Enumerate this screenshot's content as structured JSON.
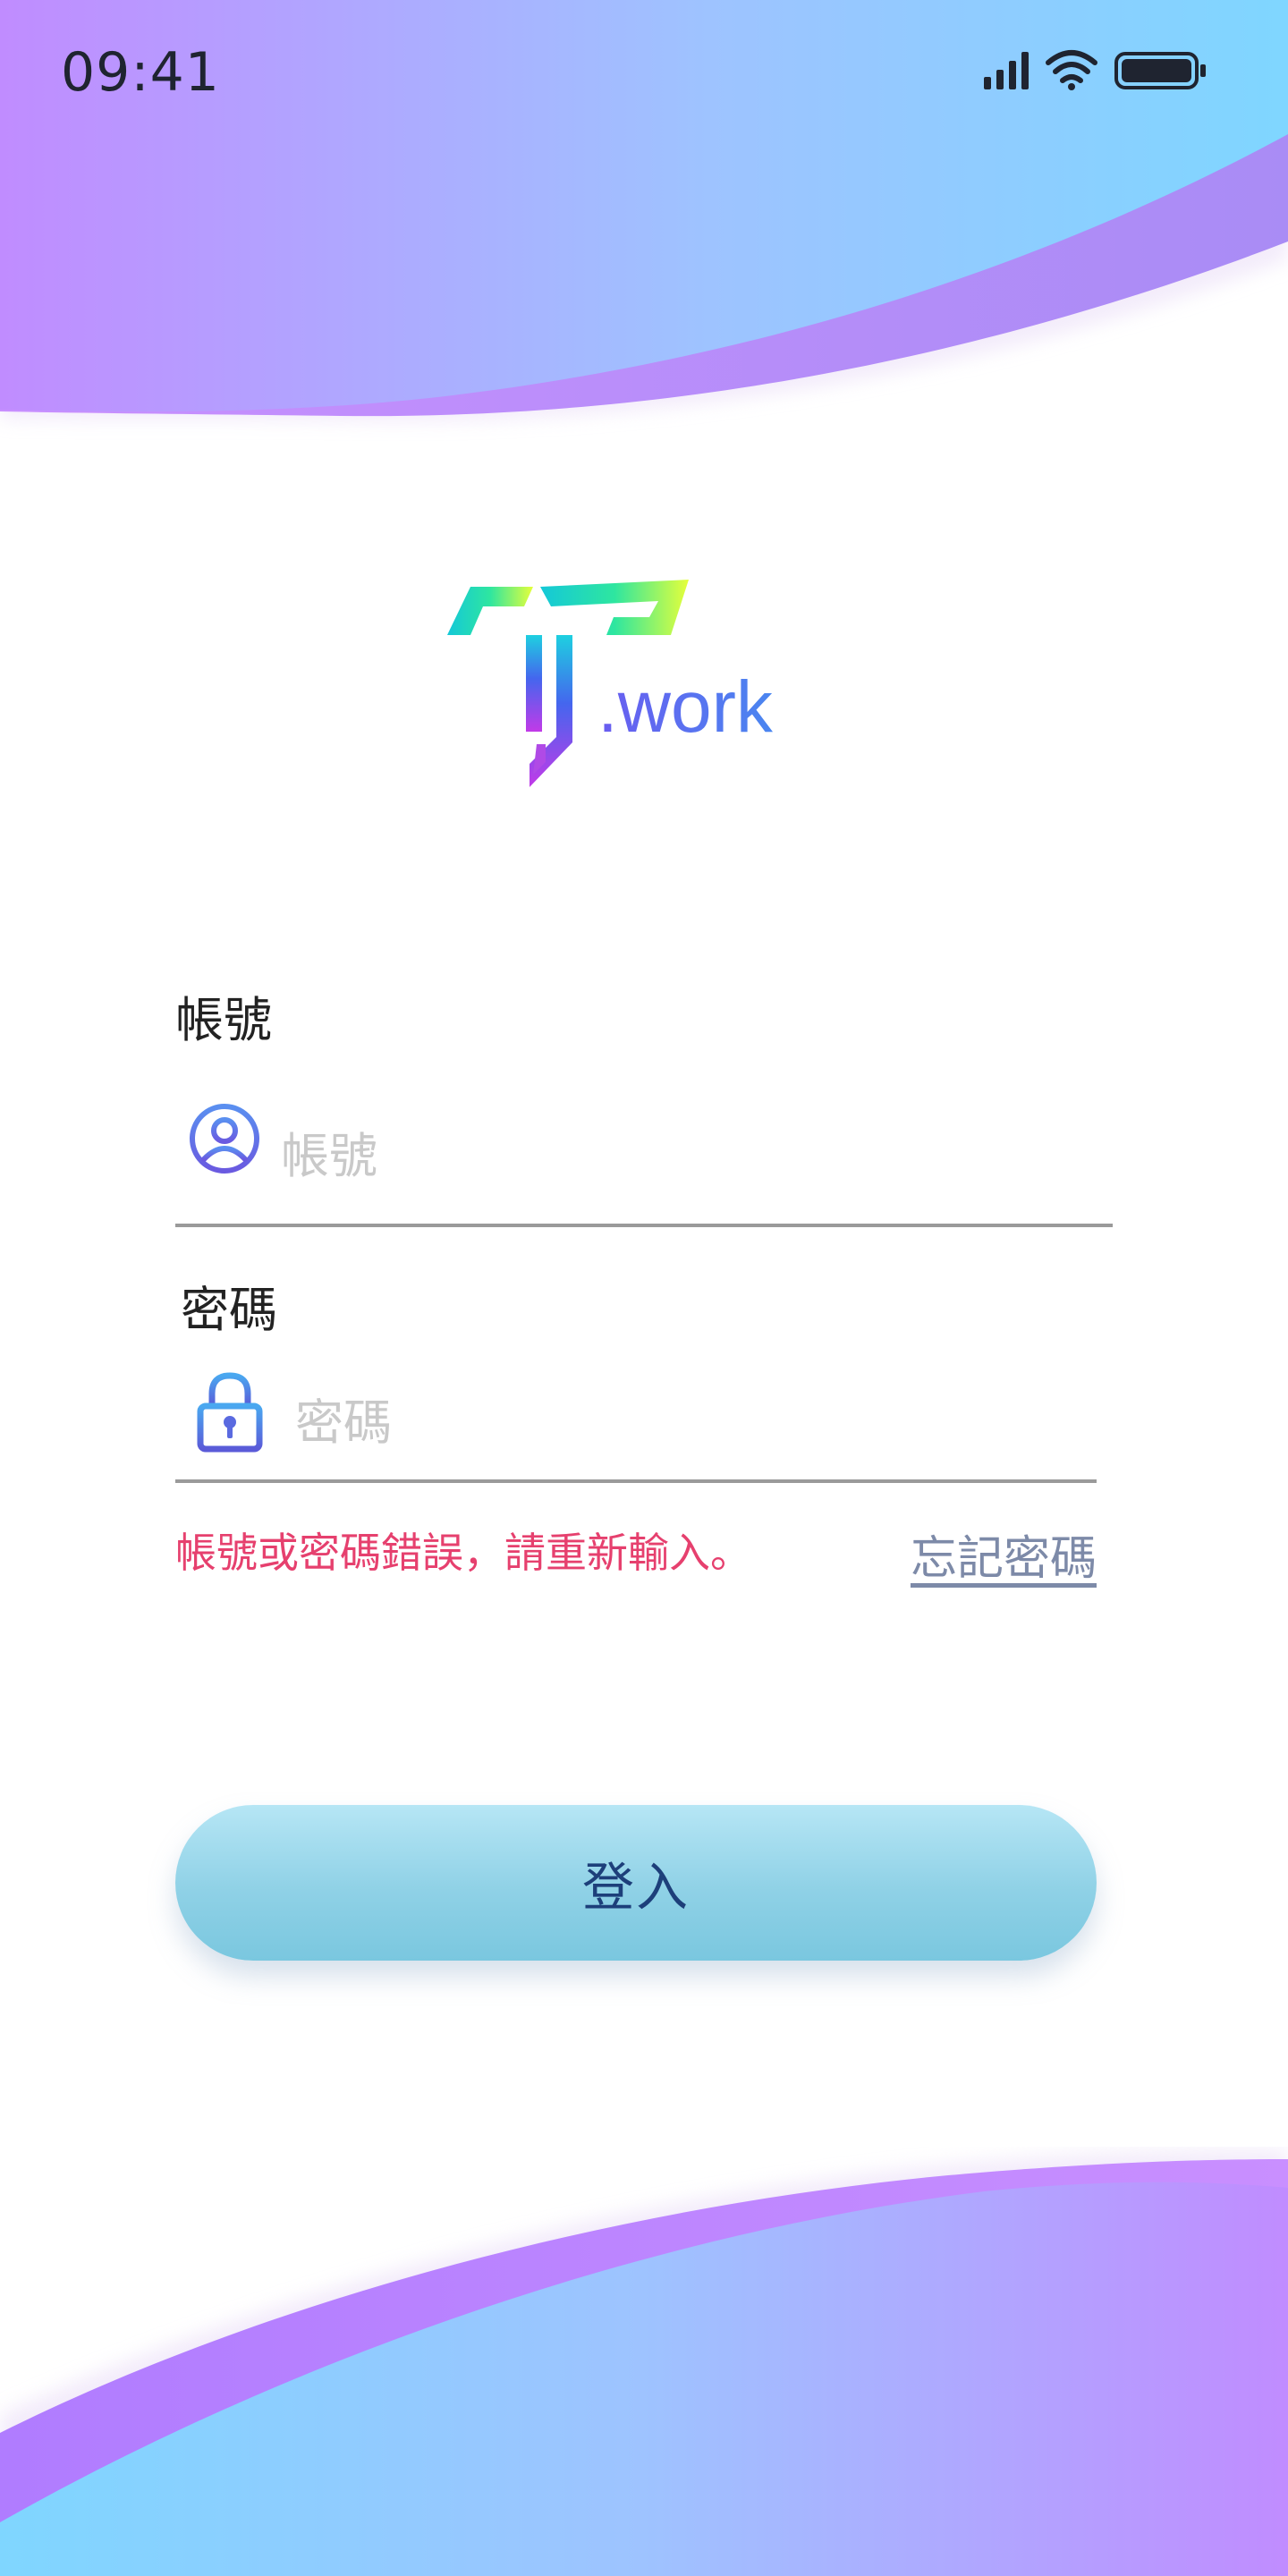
{
  "status_bar": {
    "time": "09:41",
    "icons": [
      "signal-icon",
      "wifi-icon",
      "battery-icon"
    ]
  },
  "logo": {
    "wordmark": ".work",
    "name": "TT.work"
  },
  "account": {
    "label": "帳號",
    "placeholder": "帳號",
    "value": "",
    "icon": "user-icon"
  },
  "password": {
    "label": "密碼",
    "placeholder": "密碼",
    "value": "",
    "icon": "lock-icon"
  },
  "error": {
    "message": "帳號或密碼錯誤，請重新輸入。"
  },
  "forgot": {
    "label": "忘記密碼"
  },
  "login": {
    "label": "登入"
  },
  "colors": {
    "gradient_purple": "#c08cff",
    "gradient_blue": "#7fd6ff",
    "error": "#e6406e",
    "button": "#8fd1e6",
    "button_text": "#1d3f7a"
  }
}
